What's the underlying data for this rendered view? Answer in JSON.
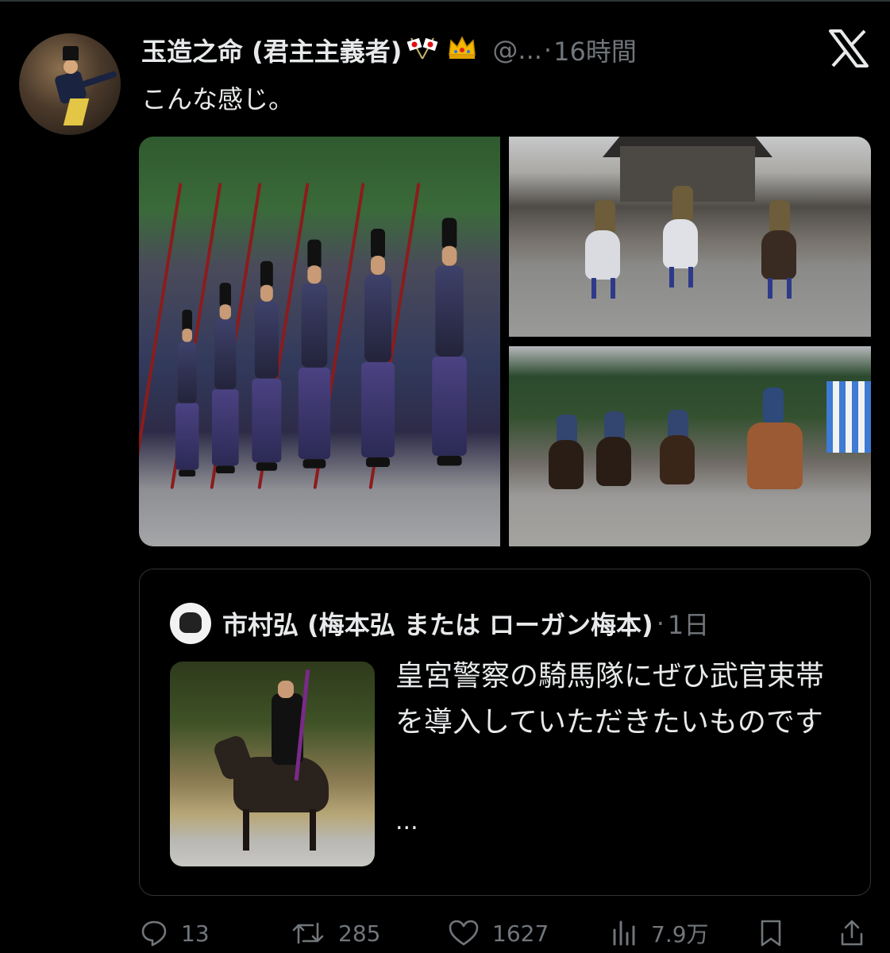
{
  "post": {
    "display_name": "玉造之命 (君主主義者)",
    "handle": "@...",
    "separator": "·",
    "timestamp": "16時間",
    "text": "こんな感じ。"
  },
  "quoted_post": {
    "display_name": "市村弘 (梅本弘 または ローガン梅本)",
    "separator": "·",
    "timestamp": "1日",
    "text": "皇宮警察の騎馬隊にぜひ武官束帯を導入していただきたいものです",
    "ellipsis": "..."
  },
  "actions": {
    "replies": "13",
    "reposts": "285",
    "likes": "1627",
    "views": "7.9万"
  },
  "colors": {
    "background": "#000000",
    "text": "#e7e9ea",
    "secondary": "#71767b",
    "border": "#2f3336"
  },
  "icons": [
    "reply-icon",
    "repost-icon",
    "like-icon",
    "views-icon",
    "bookmark-icon",
    "share-icon",
    "x-logo-icon",
    "crossed-flags-icon",
    "crown-icon"
  ]
}
